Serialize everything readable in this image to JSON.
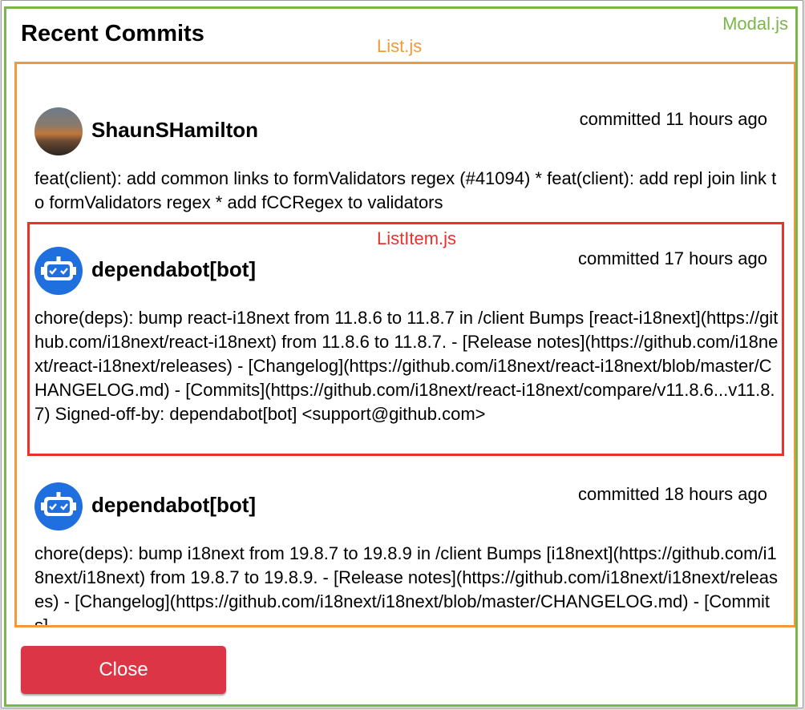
{
  "modal": {
    "title": "Recent Commits",
    "close_label": "Close"
  },
  "annotations": {
    "modal": "Modal.js",
    "list": "List.js",
    "list_item": "ListItem.js"
  },
  "colors": {
    "modal_outline": "#7bb64a",
    "list_outline": "#f3993a",
    "item_outline": "#e8322c",
    "close_button": "#dc3545",
    "bot_avatar": "#1f6fde"
  },
  "commits": [
    {
      "author": "ShaunSHamilton",
      "time": "committed 11 hours ago",
      "avatar_icon": "user-photo-avatar",
      "message": "feat(client): add common links to formValidators regex (#41094) * feat(client): add repl join link to formValidators regex * add fCCRegex to validators"
    },
    {
      "author": "dependabot[bot]",
      "time": "committed 17 hours ago",
      "avatar_icon": "robot-avatar",
      "message": "chore(deps): bump react-i18next from 11.8.6 to 11.8.7 in /client Bumps [react-i18next](https://github.com/i18next/react-i18next) from 11.8.6 to 11.8.7. - [Release notes](https://github.com/i18next/react-i18next/releases) - [Changelog](https://github.com/i18next/react-i18next/blob/master/CHANGELOG.md) - [Commits](https://github.com/i18next/react-i18next/compare/v11.8.6...v11.8.7) Signed-off-by: dependabot[bot] <support@github.com>"
    },
    {
      "author": "dependabot[bot]",
      "time": "committed 18 hours ago",
      "avatar_icon": "robot-avatar",
      "message": "chore(deps): bump i18next from 19.8.7 to 19.8.9 in /client Bumps [i18next](https://github.com/i18next/i18next) from 19.8.7 to 19.8.9. - [Release notes](https://github.com/i18next/i18next/releases) - [Changelog](https://github.com/i18next/i18next/blob/master/CHANGELOG.md) - [Commits]"
    }
  ]
}
